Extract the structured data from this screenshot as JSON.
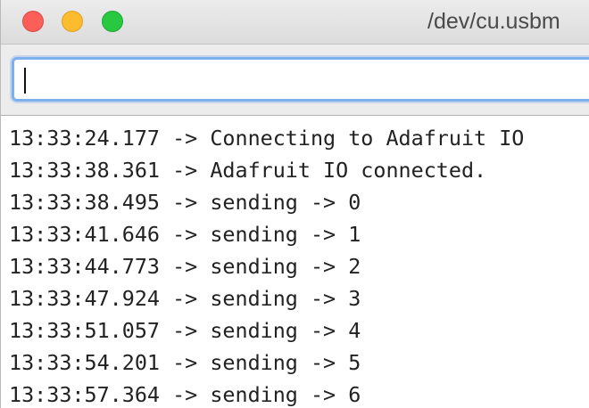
{
  "window": {
    "title": "/dev/cu.usbm"
  },
  "input": {
    "value": ""
  },
  "log": [
    "13:33:24.177 -> Connecting to Adafruit IO",
    "13:33:38.361 -> Adafruit IO connected.",
    "13:33:38.495 -> sending -> 0",
    "13:33:41.646 -> sending -> 1",
    "13:33:44.773 -> sending -> 2",
    "13:33:47.924 -> sending -> 3",
    "13:33:51.057 -> sending -> 4",
    "13:33:54.201 -> sending -> 5",
    "13:33:57.364 -> sending -> 6"
  ]
}
